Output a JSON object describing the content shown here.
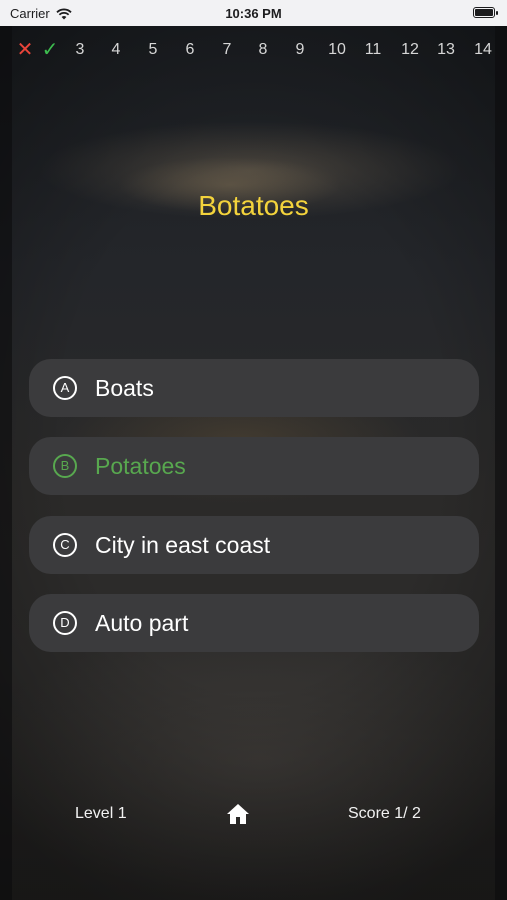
{
  "status_bar": {
    "carrier": "Carrier",
    "time": "10:36 PM"
  },
  "progress": {
    "items": [
      {
        "label": "✕",
        "state": "wrong"
      },
      {
        "label": "✓",
        "state": "correct"
      },
      {
        "label": "3",
        "state": "pending"
      },
      {
        "label": "4",
        "state": "pending"
      },
      {
        "label": "5",
        "state": "pending"
      },
      {
        "label": "6",
        "state": "pending"
      },
      {
        "label": "7",
        "state": "pending"
      },
      {
        "label": "8",
        "state": "pending"
      },
      {
        "label": "9",
        "state": "pending"
      },
      {
        "label": "10",
        "state": "pending"
      },
      {
        "label": "11",
        "state": "pending"
      },
      {
        "label": "12",
        "state": "pending"
      },
      {
        "label": "13",
        "state": "pending"
      },
      {
        "label": "14",
        "state": "pending"
      }
    ]
  },
  "question": {
    "text": "Botatoes"
  },
  "answers": [
    {
      "letter": "A",
      "text": "Boats",
      "state": "normal"
    },
    {
      "letter": "B",
      "text": "Potatoes",
      "state": "correct"
    },
    {
      "letter": "C",
      "text": "City in east coast",
      "state": "normal"
    },
    {
      "letter": "D",
      "text": "Auto part",
      "state": "normal"
    }
  ],
  "footer": {
    "level": "Level 1",
    "score": "Score 1/  2",
    "home_icon": "home-icon"
  },
  "colors": {
    "question": "#f3d33c",
    "correct": "#58a84f",
    "wrong": "#e8443a",
    "check": "#3dbd4f",
    "answer_bg": "#3b3b3d"
  }
}
